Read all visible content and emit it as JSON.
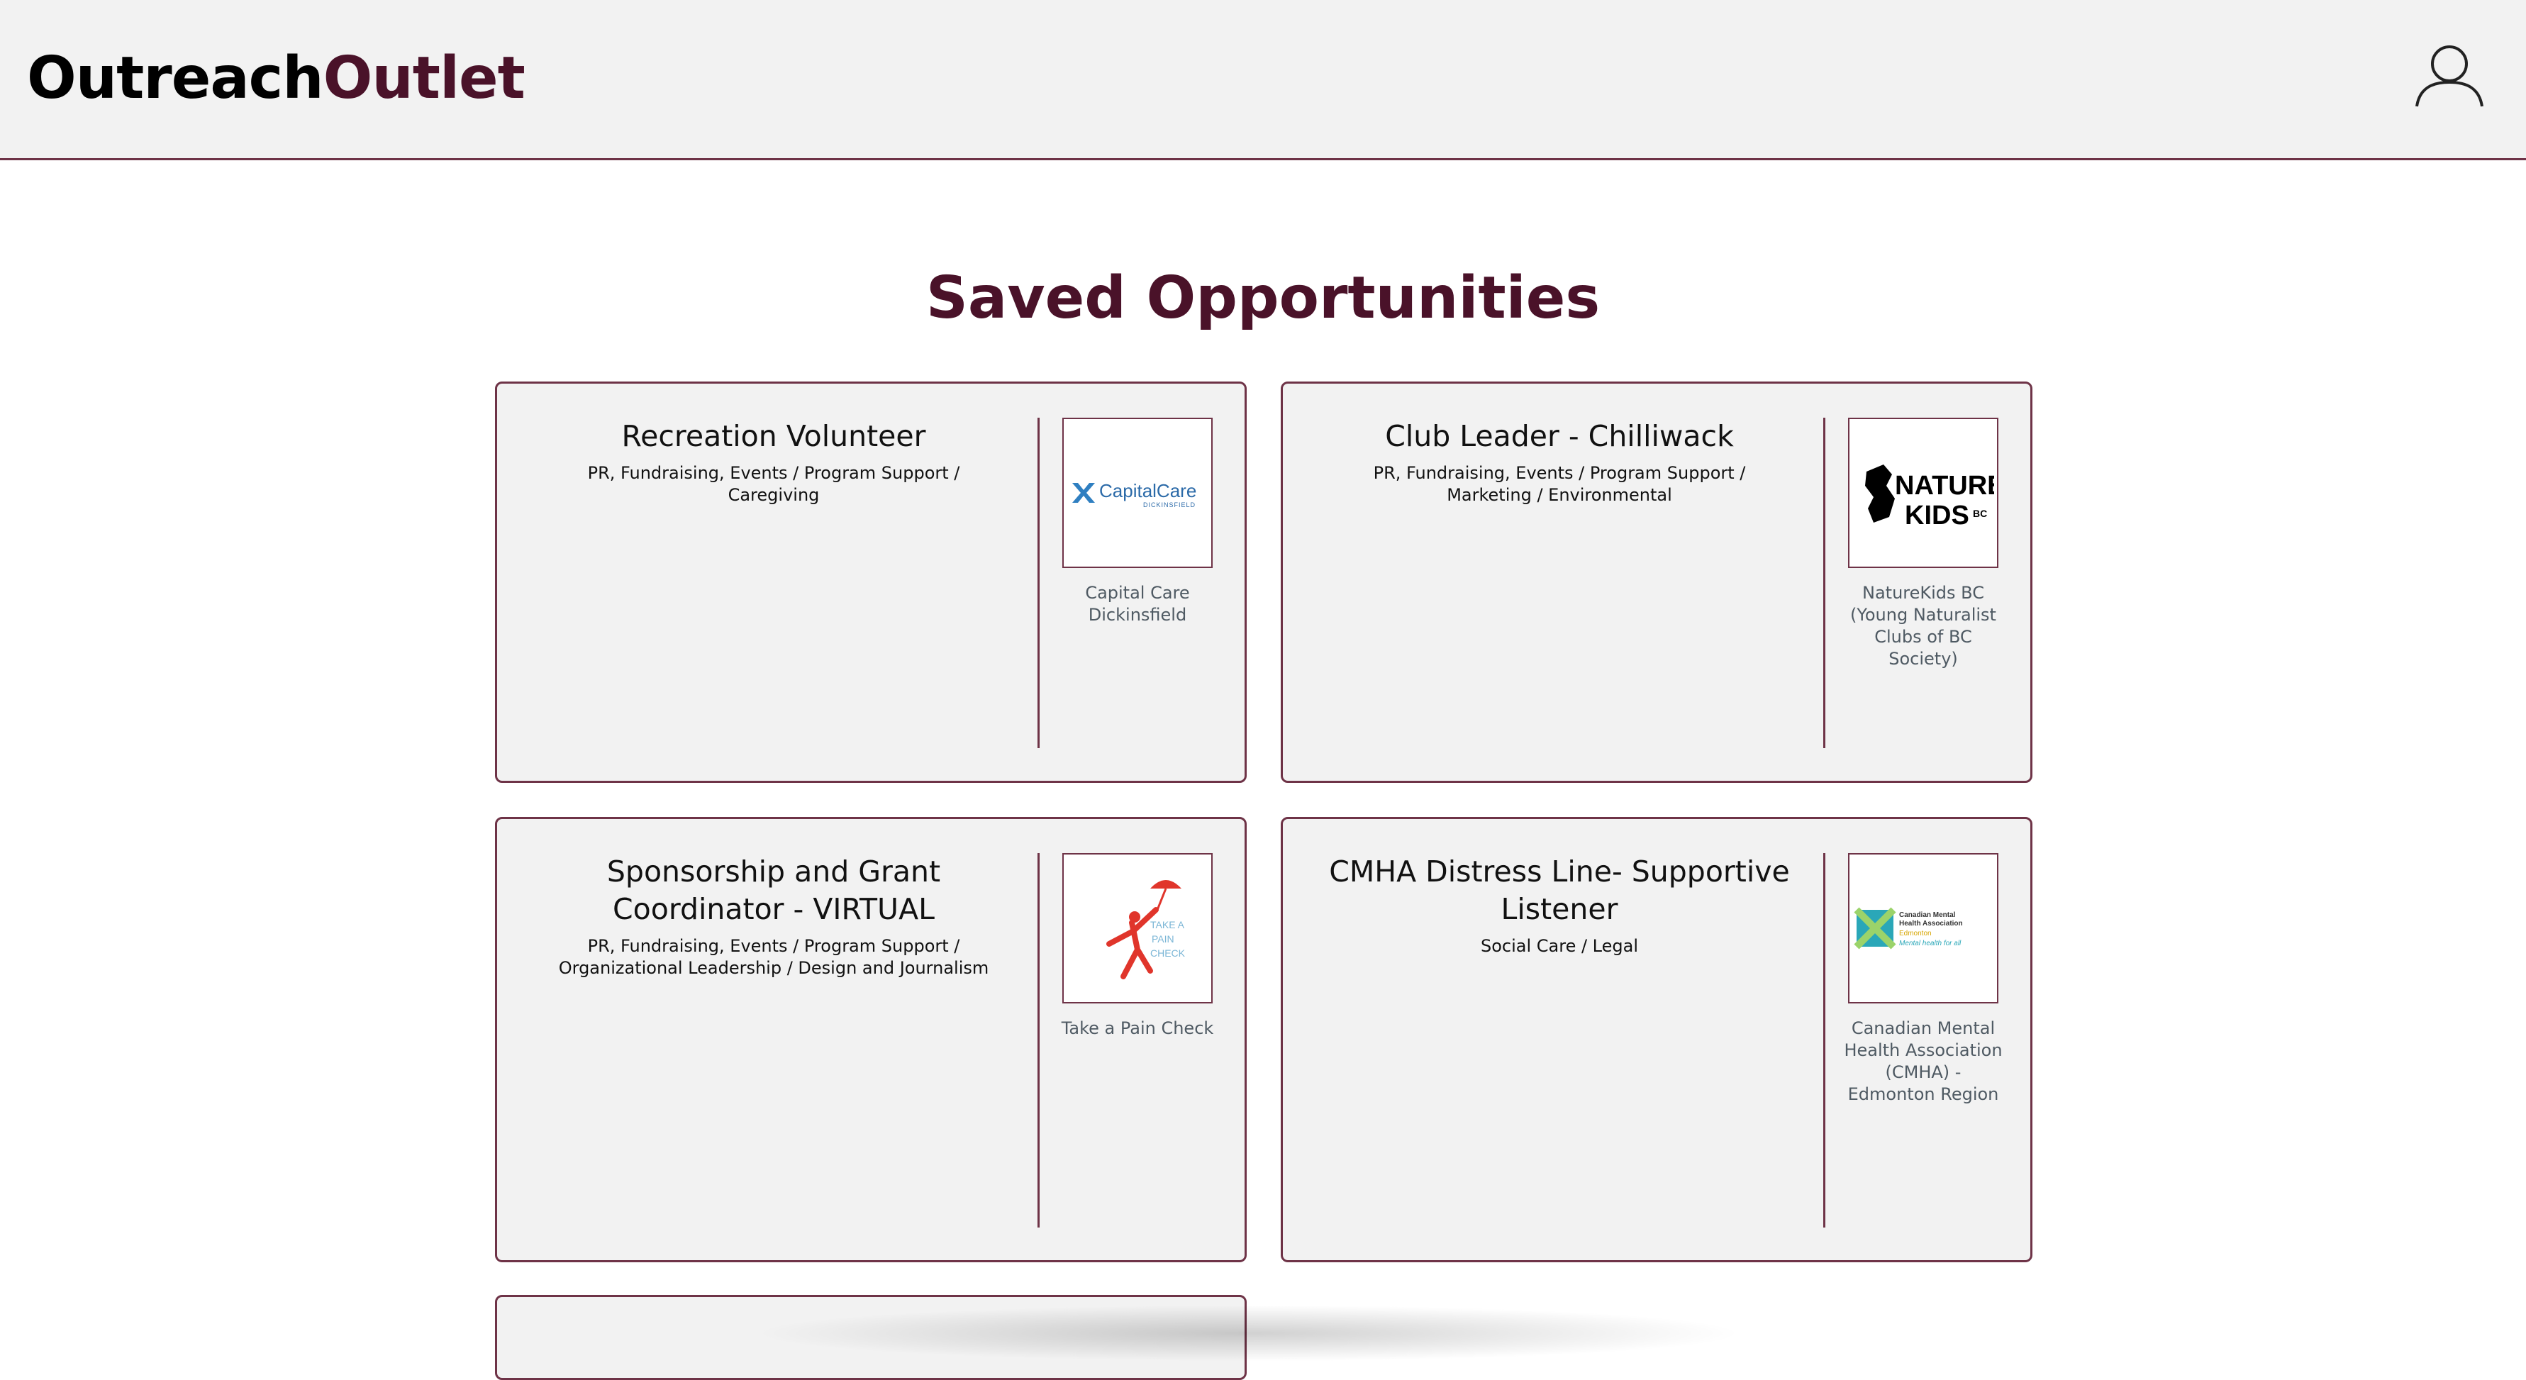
{
  "header": {
    "logo_part1": "Outreach",
    "logo_part2": "Outlet",
    "user_icon": "user-profile-icon"
  },
  "main": {
    "title": "Saved Opportunities"
  },
  "opportunities": [
    {
      "title": "Recreation Volunteer",
      "categories": "PR, Fundraising, Events / Program Support / Caregiving",
      "org_name": "Capital Care Dickinsfield",
      "logo_text": "CapitalCare",
      "logo_subtext": "DICKINSFIELD"
    },
    {
      "title": "Club Leader - Chilliwack",
      "categories": "PR, Fundraising, Events / Program Support / Marketing / Environmental",
      "org_name": "NatureKids BC (Young Naturalist Clubs of BC Society)",
      "logo_text": "NATURE KIDS",
      "logo_subtext": "BC"
    },
    {
      "title": "Sponsorship and Grant Coordinator - VIRTUAL",
      "categories": "PR, Fundraising, Events / Program Support / Organizational Leadership / Design and Journalism",
      "org_name": "Take a Pain Check",
      "logo_text": "TAKE A PAIN CHECK"
    },
    {
      "title": "CMHA Distress Line- Supportive Listener",
      "categories": "Social Care / Legal",
      "org_name": "Canadian Mental Health Association (CMHA) - Edmonton Region",
      "logo_text": "Canadian Mental Health Association",
      "logo_subtext": "Edmonton",
      "logo_tagline": "Mental health for all"
    }
  ],
  "colors": {
    "brand_accent": "#4a1229",
    "border": "#6e3347",
    "card_bg": "#f2f2f2",
    "header_bg": "#f2f2f2"
  }
}
